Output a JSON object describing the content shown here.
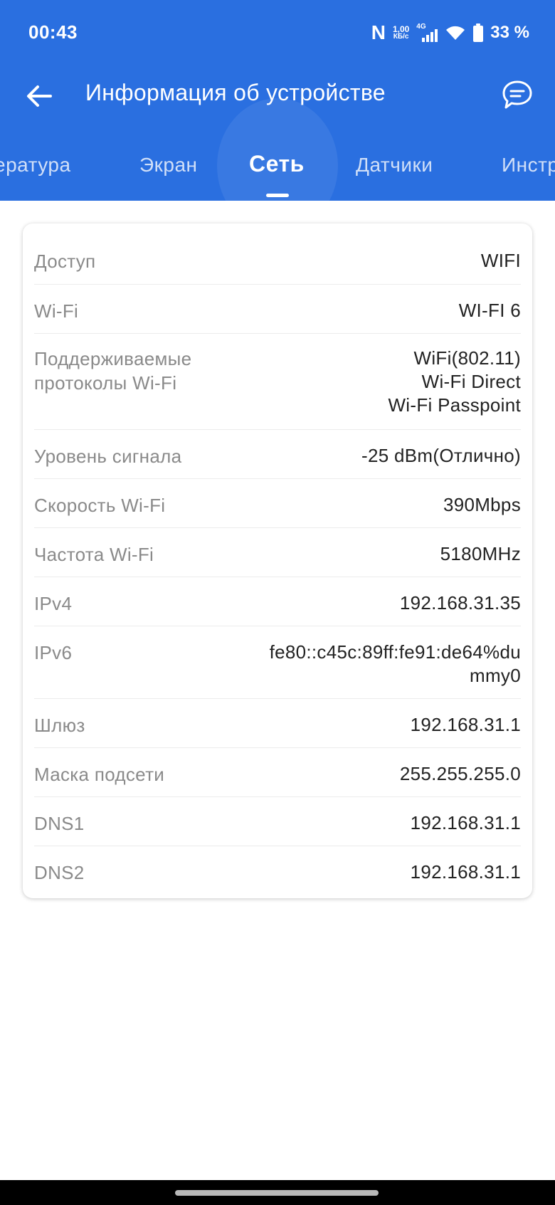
{
  "status_bar": {
    "time": "00:43",
    "nfc": "N",
    "speed_value": "1,00",
    "speed_unit": "КБ/с",
    "network_type": "4G",
    "battery": "33 %"
  },
  "header": {
    "title": "Информация об устройстве",
    "back_icon": "arrow-left-icon",
    "feedback_icon": "chat-bubble-icon",
    "background_color": "#2a6fe0"
  },
  "tabs": [
    {
      "label": "ература",
      "active": false
    },
    {
      "label": "Экран",
      "active": false
    },
    {
      "label": "Сеть",
      "active": true
    },
    {
      "label": "Датчики",
      "active": false
    },
    {
      "label": "Инстр",
      "active": false
    }
  ],
  "network_info": [
    {
      "label": "Доступ",
      "value": [
        "WIFI"
      ]
    },
    {
      "label": "Wi-Fi",
      "value": [
        "WI-FI 6"
      ]
    },
    {
      "label": "Поддерживаемые протоколы Wi-Fi",
      "value": [
        "WiFi(802.11)",
        "Wi-Fi Direct",
        "Wi-Fi Passpoint"
      ]
    },
    {
      "label": "Уровень сигнала",
      "value": [
        "-25 dBm(Отлично)"
      ]
    },
    {
      "label": "Скорость Wi-Fi",
      "value": [
        "390Mbps"
      ]
    },
    {
      "label": "Частота Wi-Fi",
      "value": [
        "5180MHz"
      ]
    },
    {
      "label": "IPv4",
      "value": [
        "192.168.31.35"
      ]
    },
    {
      "label": "IPv6",
      "value": [
        "fe80::c45c:89ff:fe91:de64%du",
        "mmy0"
      ]
    },
    {
      "label": "Шлюз",
      "value": [
        "192.168.31.1"
      ]
    },
    {
      "label": "Маска подсети",
      "value": [
        "255.255.255.0"
      ]
    },
    {
      "label": "DNS1",
      "value": [
        "192.168.31.1"
      ]
    },
    {
      "label": "DNS2",
      "value": [
        "192.168.31.1"
      ]
    }
  ]
}
